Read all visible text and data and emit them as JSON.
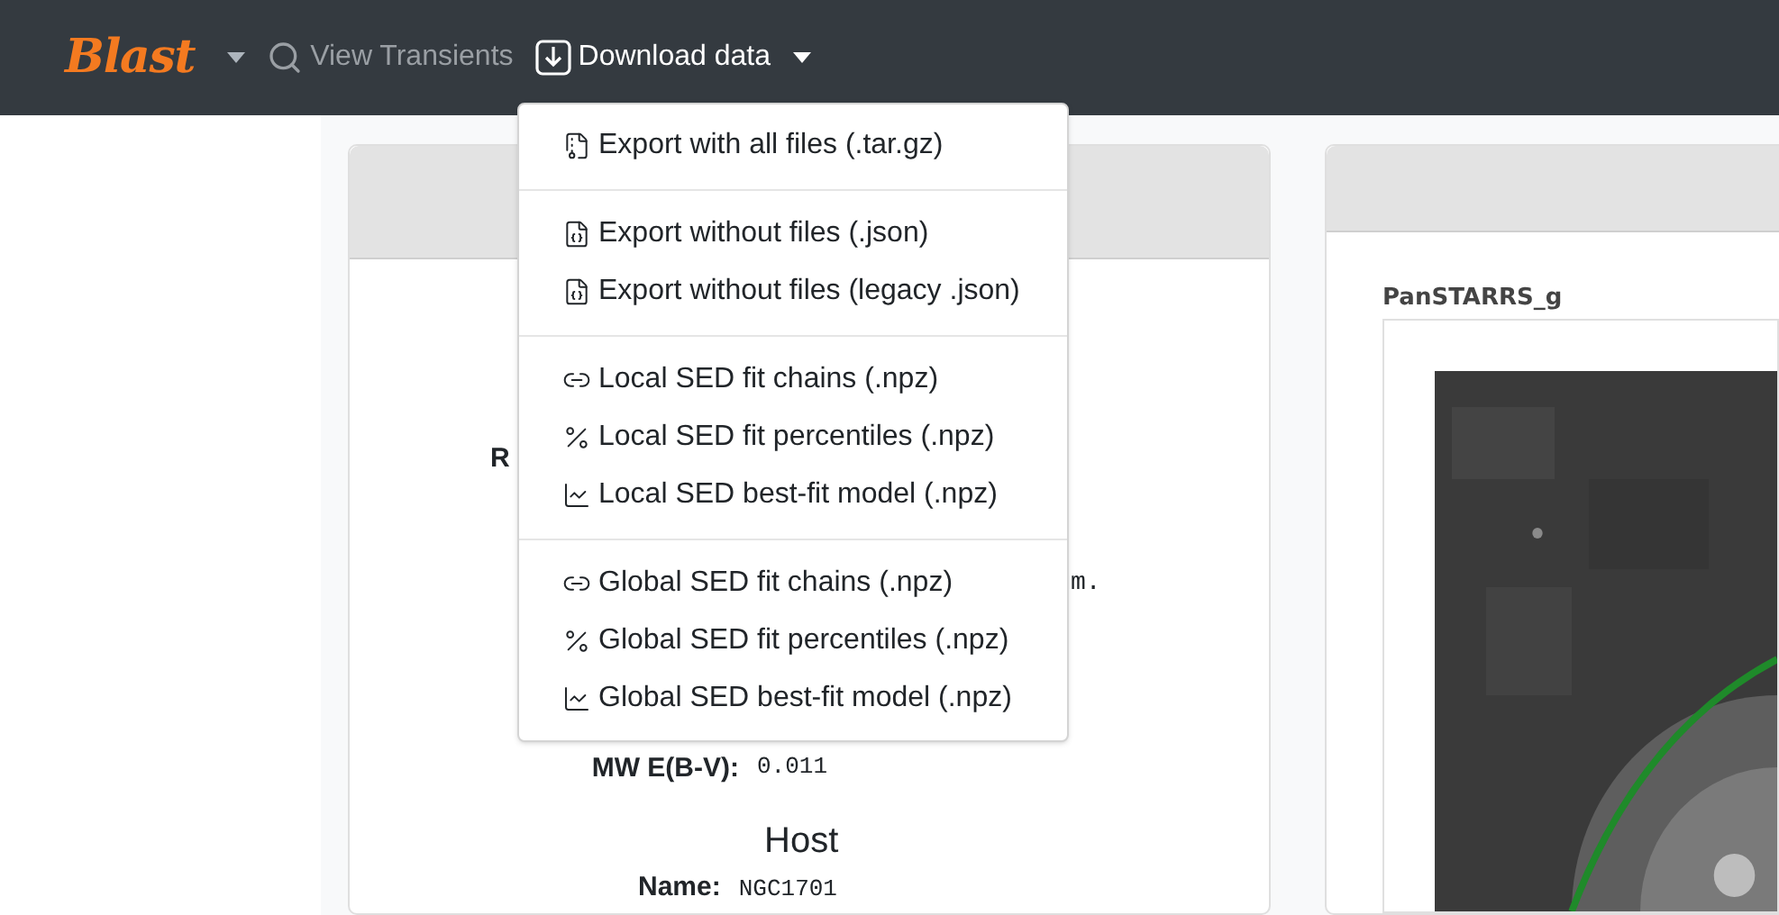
{
  "navbar": {
    "brand": "Blast",
    "links": [
      {
        "label": "View Transients",
        "kind": "search",
        "active": false
      },
      {
        "label": "Download data",
        "kind": "download",
        "active": true
      }
    ]
  },
  "download_menu": {
    "groups": [
      [
        {
          "label": "Export with all files (.tar.gz)",
          "kind": "archive"
        }
      ],
      [
        {
          "label": "Export without files (.json)",
          "kind": "json"
        },
        {
          "label": "Export without files (legacy .json)",
          "kind": "json"
        }
      ],
      [
        {
          "label": "Local SED fit chains (.npz)",
          "kind": "chain"
        },
        {
          "label": "Local SED fit percentiles (.npz)",
          "kind": "percent"
        },
        {
          "label": "Local SED best-fit model (.npz)",
          "kind": "chart"
        }
      ],
      [
        {
          "label": "Global SED fit chains (.npz)",
          "kind": "chain"
        },
        {
          "label": "Global SED fit percentiles (.npz)",
          "kind": "percent"
        },
        {
          "label": "Global SED best-fit model (.npz)",
          "kind": "chart"
        }
      ]
    ]
  },
  "info_card": {
    "partial_label": "R",
    "partial_value": "m.",
    "fields": [
      {
        "label": "MW E(B-V):",
        "value": "0.011"
      }
    ],
    "host_heading": "Host",
    "host_fields": [
      {
        "label": "Name:",
        "value": "NGC1701"
      }
    ]
  },
  "image_card": {
    "cutout_title": "PanSTARRS_g"
  }
}
